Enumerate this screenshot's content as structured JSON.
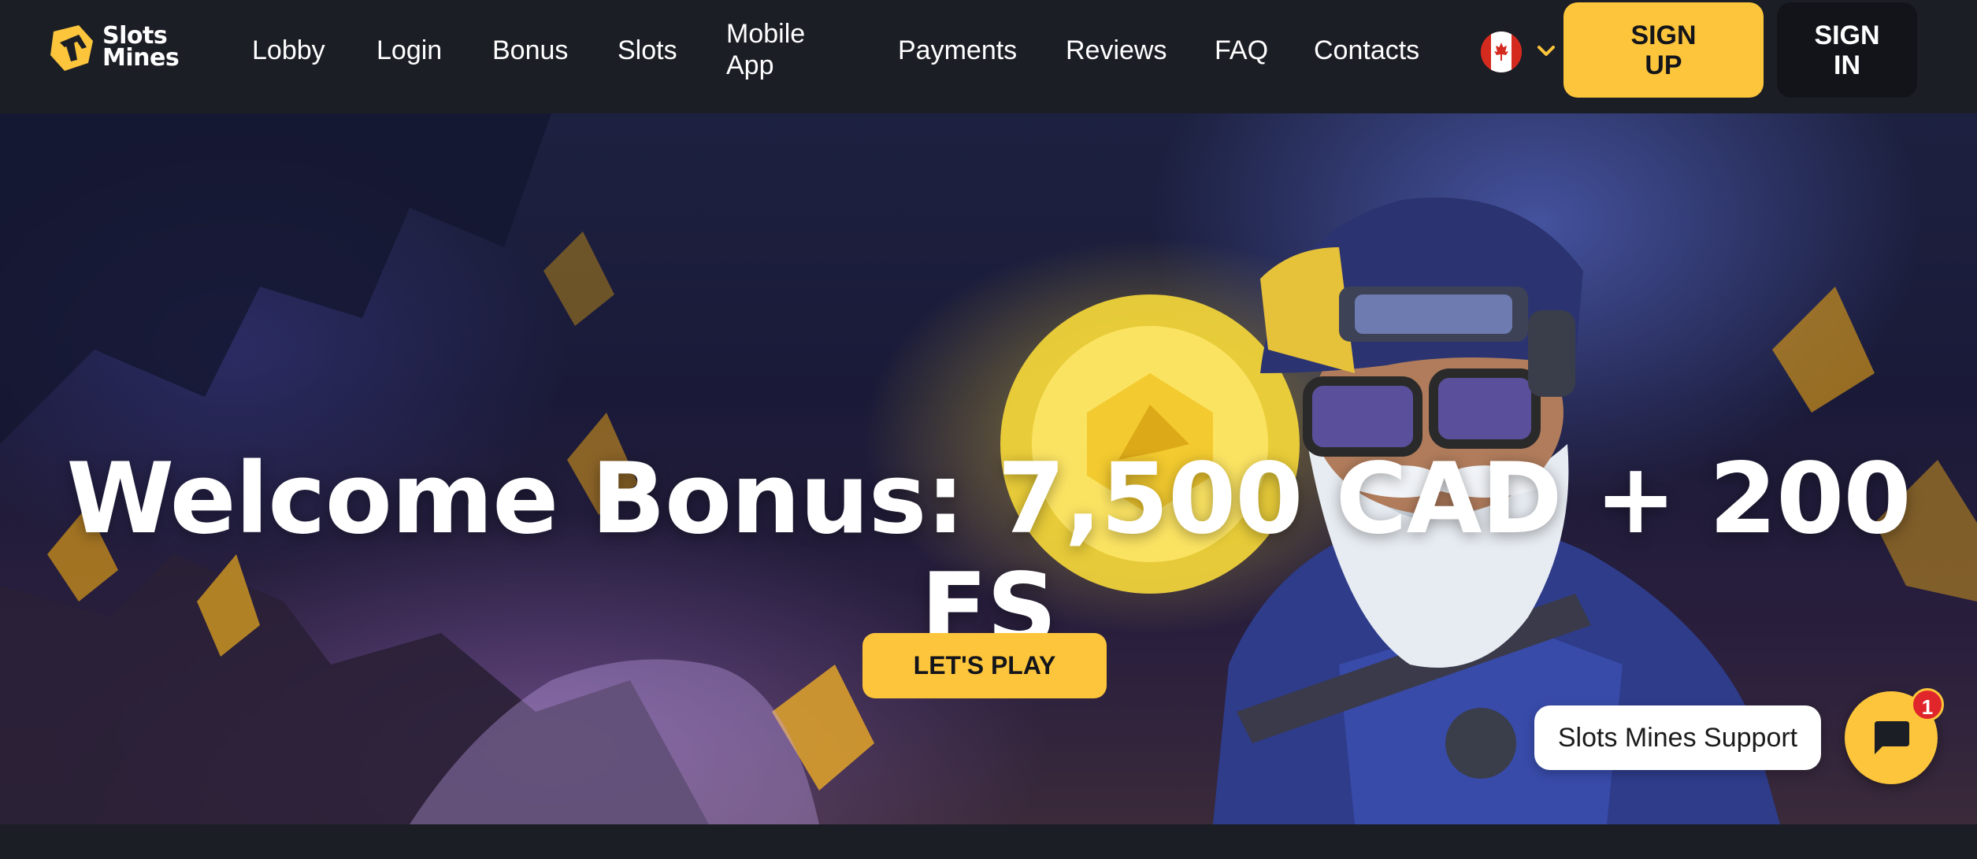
{
  "brand": {
    "line1": "Slots",
    "line2": "Mines"
  },
  "nav": {
    "items": [
      {
        "label": "Lobby"
      },
      {
        "label": "Login"
      },
      {
        "label": "Bonus"
      },
      {
        "label": "Slots"
      },
      {
        "label": "Mobile App"
      },
      {
        "label": "Payments"
      },
      {
        "label": "Reviews"
      },
      {
        "label": "FAQ"
      },
      {
        "label": "Contacts"
      }
    ]
  },
  "language": {
    "icon": "canada-flag-icon",
    "dropdown_icon": "chevron-down-icon"
  },
  "auth": {
    "signup_label": "SIGN UP",
    "signin_label": "SIGN IN"
  },
  "hero": {
    "title": "Welcome Bonus: 7,500 CAD + 200 FS",
    "cta_label": "LET'S PLAY"
  },
  "support": {
    "label": "Slots Mines Support",
    "icon": "chat-icon",
    "unread_count": "1"
  },
  "colors": {
    "accent": "#fcc53b",
    "header_bg": "#1c1e26",
    "signin_bg": "#12141a",
    "badge": "#e0262a"
  }
}
